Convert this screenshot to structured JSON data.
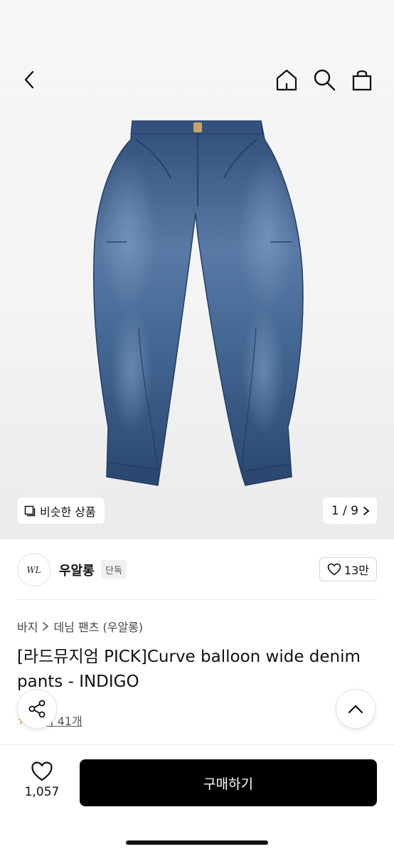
{
  "gallery": {
    "similar_label": "비슷한 상품",
    "counter": "1 / 9",
    "current_index": 1,
    "total": 9
  },
  "nav": {
    "back_icon": "chevron-left-icon",
    "home_icon": "home-icon",
    "search_icon": "search-icon",
    "bag_icon": "shopping-bag-icon"
  },
  "brand": {
    "logo_text": "WL",
    "name": "우알롱",
    "badge": "단독",
    "likes": "13만"
  },
  "product": {
    "breadcrumb": [
      "바지",
      "데님 팬츠 (우알롱)"
    ],
    "title": "[라드뮤지엄 PICK]Curve balloon wide denim pants - INDIGO",
    "reviews_label": "후기 41개"
  },
  "bottom": {
    "wish_count": "1,057",
    "buy_label": "구매하기"
  },
  "colors": {
    "accent": "#000000",
    "star": "#f5a623",
    "denim": "#3d5f8c"
  }
}
